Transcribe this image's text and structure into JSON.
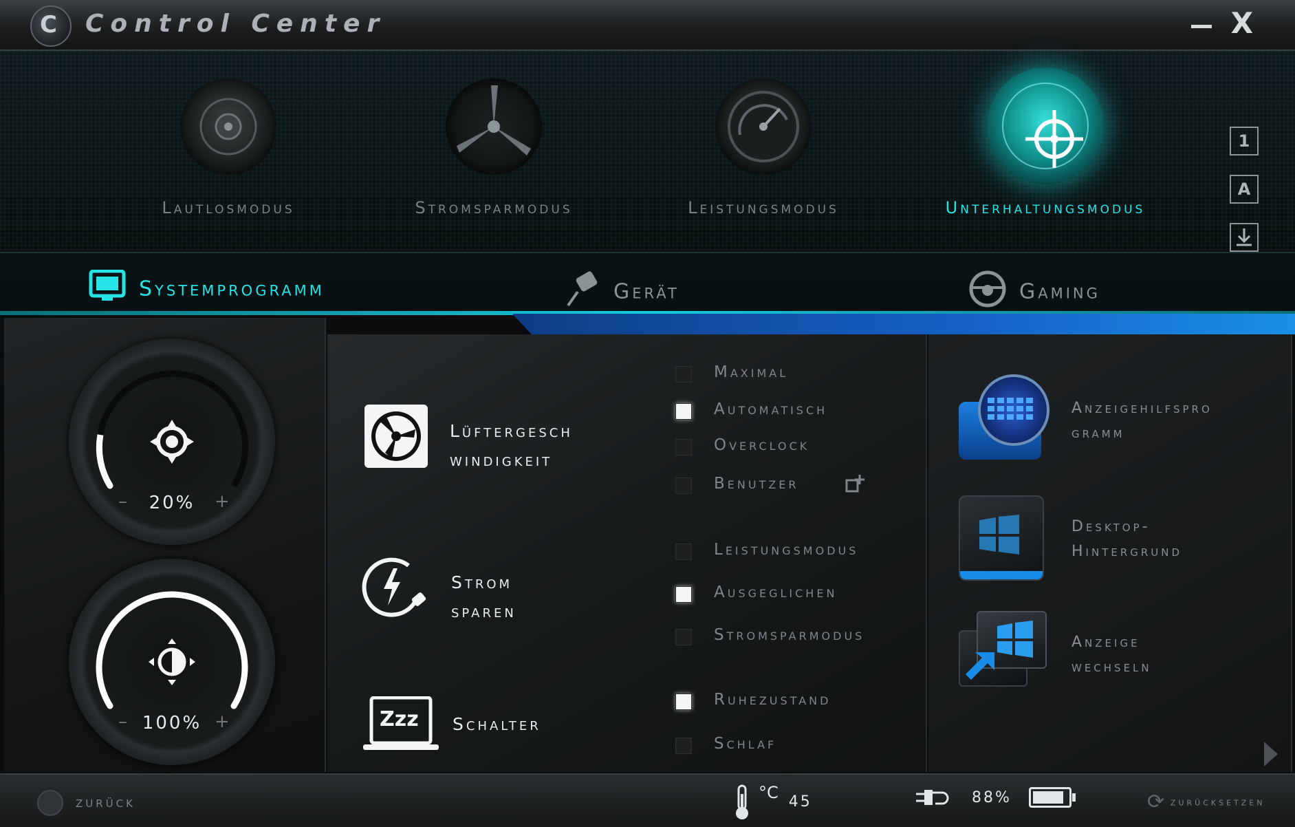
{
  "window": {
    "title": "Control Center",
    "minimize_icon": "minimize-icon",
    "close_glyph": "X"
  },
  "modes": [
    {
      "label": "Lautlosmodus",
      "icon": "speaker-icon",
      "active": false
    },
    {
      "label": "Stromsparmodus",
      "icon": "fan-blades-icon",
      "active": false
    },
    {
      "label": "Leistungsmodus",
      "icon": "speedometer-icon",
      "active": false
    },
    {
      "label": "Unterhaltungsmodus",
      "icon": "crosshair-icon",
      "active": true
    }
  ],
  "side_icons": [
    {
      "label": "1",
      "icon": "profile-1-icon"
    },
    {
      "label": "A",
      "icon": "caps-lock-icon"
    },
    {
      "label": "",
      "icon": "download-icon"
    },
    {
      "label": "",
      "icon": "airplane-icon"
    }
  ],
  "categories": [
    {
      "label": "Systemprogramm",
      "icon": "monitor-icon",
      "active": true
    },
    {
      "label": "Gerät",
      "icon": "plug-icon",
      "active": false
    },
    {
      "label": "Gaming",
      "icon": "steering-wheel-icon",
      "active": false
    }
  ],
  "dials": {
    "fan": {
      "value_text": "20%",
      "level": 0.2,
      "minus": "–",
      "plus": "+",
      "icon": "fan-target-icon"
    },
    "brightness": {
      "value_text": "100%",
      "level": 1.0,
      "minus": "–",
      "plus": "+",
      "icon": "brightness-icon"
    }
  },
  "features": {
    "fan_speed": {
      "label_line1": "Lüftergesch",
      "label_line2": "windigkeit",
      "icon": "fan-icon"
    },
    "power_saving": {
      "label": "Strom sparen",
      "icon": "power-plug-icon"
    },
    "switch": {
      "label": "Schalter",
      "icon": "sleep-laptop-icon",
      "glyph": "Zzz"
    }
  },
  "fan_options": [
    {
      "label": "Maximal",
      "checked": false
    },
    {
      "label": "Automatisch",
      "checked": true
    },
    {
      "label": "Overclock",
      "checked": false
    },
    {
      "label": "Benutzer",
      "checked": false
    }
  ],
  "power_options": [
    {
      "label": "Leistungsmodus",
      "checked": false
    },
    {
      "label": "Ausgeglichen",
      "checked": true
    },
    {
      "label": "Stromsparmodus",
      "checked": false
    }
  ],
  "switch_options": [
    {
      "label": "Ruhezustand",
      "checked": true
    },
    {
      "label": "Schlaf",
      "checked": false
    }
  ],
  "display_items": [
    {
      "line1": "Anzeigehilfspro",
      "line2": "gramm",
      "icon": "display-grid-icon"
    },
    {
      "line1": "Desktop-",
      "line2": "Hintergrund",
      "icon": "windows-wallpaper-icon"
    },
    {
      "line1": "Anzeige",
      "line2": "wechseln",
      "icon": "display-switch-icon"
    }
  ],
  "status": {
    "back_label": "zurück",
    "temperature_unit": "°C",
    "temperature": "45",
    "battery_percent": "88%",
    "battery_level": 0.88,
    "reset_label": "zurücksetzen"
  },
  "colors": {
    "accent": "#25e3e6",
    "strip_blue": "#1662c8"
  }
}
